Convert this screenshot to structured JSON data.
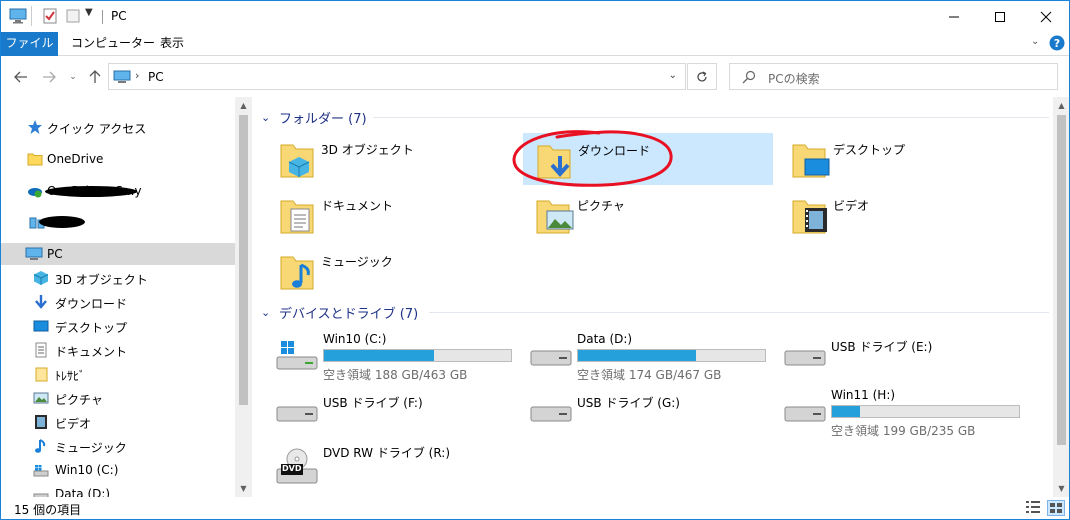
{
  "window": {
    "title": "PC",
    "colors": {
      "accent": "#1979ca",
      "selection": "#cce8ff",
      "group_header": "#1e3287",
      "bar_fill": "#26a0da",
      "annotation": "#e81123"
    }
  },
  "ribbon": {
    "tabs": [
      {
        "label": "ファイル"
      },
      {
        "label": "コンピューター"
      },
      {
        "label": "表示"
      }
    ]
  },
  "address": {
    "path": "PC",
    "search_placeholder": "PCの検索"
  },
  "nav": {
    "items": [
      {
        "label": "クイック アクセス",
        "icon": "star-icon"
      },
      {
        "label": "OneDrive",
        "icon": "folder-icon"
      },
      {
        "label": "OneDrive - S...y",
        "icon": "onedrive-business-icon"
      },
      {
        "label": "",
        "icon": "network-icon"
      },
      {
        "label": "PC",
        "icon": "pc-icon"
      },
      {
        "label": "3D オブジェクト",
        "icon": "3d-objects-icon"
      },
      {
        "label": "ダウンロード",
        "icon": "download-icon"
      },
      {
        "label": "デスクトップ",
        "icon": "desktop-icon"
      },
      {
        "label": "ドキュメント",
        "icon": "documents-icon"
      },
      {
        "label": "ﾄﾚｻﾋﾞ",
        "icon": "folder-icon"
      },
      {
        "label": "ピクチャ",
        "icon": "pictures-icon"
      },
      {
        "label": "ビデオ",
        "icon": "videos-icon"
      },
      {
        "label": "ミュージック",
        "icon": "music-icon"
      },
      {
        "label": "Win10 (C:)",
        "icon": "windows-drive-icon"
      },
      {
        "label": "Data (D:)",
        "icon": "drive-icon"
      }
    ]
  },
  "folders": {
    "header": "フォルダー (7)",
    "items": [
      {
        "name": "3D オブジェクト",
        "icon": "3d-objects-folder-icon"
      },
      {
        "name": "ダウンロード",
        "icon": "download-folder-icon"
      },
      {
        "name": "デスクトップ",
        "icon": "desktop-folder-icon"
      },
      {
        "name": "ドキュメント",
        "icon": "documents-folder-icon"
      },
      {
        "name": "ピクチャ",
        "icon": "pictures-folder-icon"
      },
      {
        "name": "ビデオ",
        "icon": "videos-folder-icon"
      },
      {
        "name": "ミュージック",
        "icon": "music-folder-icon"
      }
    ]
  },
  "drives": {
    "header": "デバイスとドライブ (7)",
    "items": [
      {
        "name": "Win10 (C:)",
        "free": "空き領域 188 GB/463 GB",
        "used_fraction": 0.59,
        "icon": "windows-drive-icon"
      },
      {
        "name": "Data (D:)",
        "free": "空き領域 174 GB/467 GB",
        "used_fraction": 0.63,
        "icon": "drive-icon"
      },
      {
        "name": "USB ドライブ (E:)",
        "free": "",
        "used_fraction": null,
        "icon": "usb-drive-icon"
      },
      {
        "name": "USB ドライブ (F:)",
        "free": "",
        "used_fraction": null,
        "icon": "usb-drive-icon"
      },
      {
        "name": "USB ドライブ (G:)",
        "free": "",
        "used_fraction": null,
        "icon": "usb-drive-icon"
      },
      {
        "name": "Win11 (H:)",
        "free": "空き領域 199 GB/235 GB",
        "used_fraction": 0.15,
        "icon": "drive-icon"
      },
      {
        "name": "DVD RW ドライブ (R:)",
        "free": "",
        "used_fraction": null,
        "icon": "dvd-drive-icon",
        "badge": "DVD"
      }
    ]
  },
  "status": {
    "count": "15 個の項目"
  }
}
